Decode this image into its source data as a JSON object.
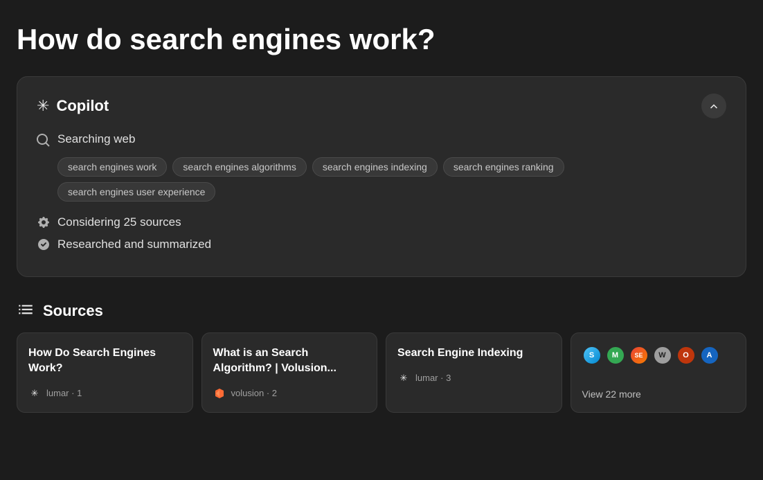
{
  "page": {
    "title": "How do search engines work?"
  },
  "copilot": {
    "label": "Copilot",
    "collapse_label": "collapse",
    "searching_label": "Searching web",
    "tags": [
      "search engines work",
      "search engines algorithms",
      "search engines indexing",
      "search engines ranking",
      "search engines user experience"
    ],
    "considering_label": "Considering 25 sources",
    "summarized_label": "Researched and summarized"
  },
  "sources": {
    "title": "Sources",
    "cards": [
      {
        "title": "How Do Search Engines Work?",
        "logo_type": "lumar",
        "source": "lumar",
        "number": "1"
      },
      {
        "title": "What is an Search Algorithm? | Volusion...",
        "logo_type": "volusion",
        "source": "volusion",
        "number": "2"
      },
      {
        "title": "Search Engine Indexing",
        "logo_type": "lumar",
        "source": "lumar",
        "number": "3"
      }
    ],
    "more": {
      "label": "View 22 more",
      "favicons": [
        {
          "color": "#4285F4",
          "letter": "S"
        },
        {
          "color": "#34A853",
          "letter": "M"
        },
        {
          "color": "#EA4335",
          "letter": "S"
        },
        {
          "color": "#9E9E9E",
          "letter": "W"
        },
        {
          "color": "#FF6B35",
          "letter": "O"
        },
        {
          "color": "#1565C0",
          "letter": "A"
        }
      ]
    }
  }
}
